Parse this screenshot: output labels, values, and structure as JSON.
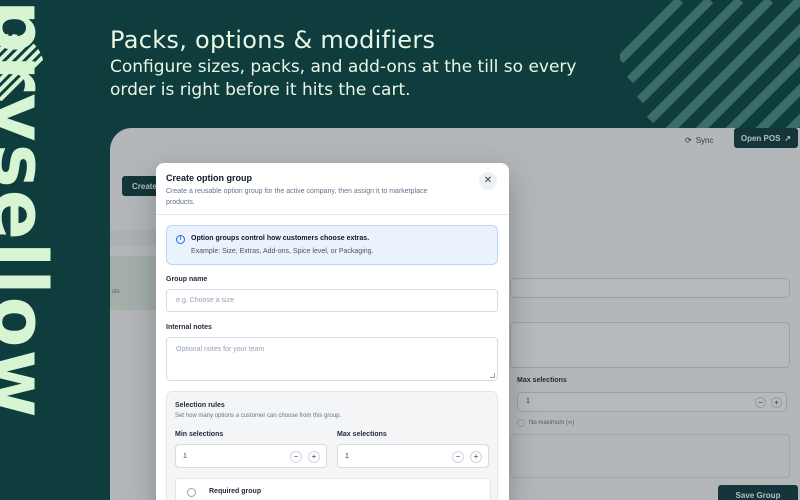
{
  "brand": {
    "vertical_text": "prysellow"
  },
  "hero": {
    "title": "Packs, options & modifiers",
    "subtitle": "Configure sizes, packs, and add-ons at the till so every order is right before it hits the cart."
  },
  "colors": {
    "background": "#0f3d3e",
    "accent_text": "#d7f5d2",
    "primary_button": "#0f3d3e",
    "info_bg": "#eaf2fd"
  },
  "app": {
    "topbar": {
      "sync_label": "Sync",
      "open_pos_label": "Open POS"
    },
    "create_button_label": "Create",
    "background_tiny_text": "cts",
    "max_selections_label": "Max selections",
    "max_selections_value": "1",
    "no_maximum_label": "No maximum (∞)",
    "save_group_label": "Save Group"
  },
  "modal": {
    "title": "Create option group",
    "description": "Create a reusable option group for the active company, then assign it to marketplace products.",
    "info": {
      "title": "Option groups control how customers choose extras.",
      "text": "Example: Size, Extras, Add-ons, Spice level, or Packaging."
    },
    "group_name": {
      "label": "Group name",
      "placeholder": "e.g. Choose a size"
    },
    "internal_notes": {
      "label": "Internal notes",
      "placeholder": "Optional notes for your team"
    },
    "selection_rules": {
      "title": "Selection rules",
      "description": "Set how many options a customer can choose from this group.",
      "min_label": "Min selections",
      "min_value": "1",
      "max_label": "Max selections",
      "max_value": "1",
      "required_label": "Required group"
    }
  }
}
